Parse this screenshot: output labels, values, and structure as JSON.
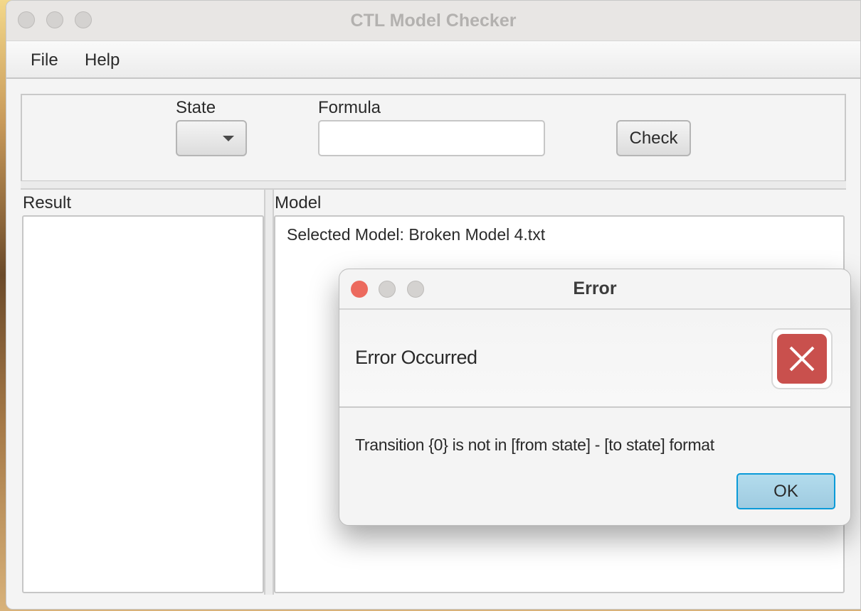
{
  "window": {
    "title": "CTL Model Checker"
  },
  "menu": {
    "items": [
      {
        "label": "File"
      },
      {
        "label": "Help"
      }
    ]
  },
  "controls": {
    "state_label": "State",
    "state_value": "",
    "formula_label": "Formula",
    "formula_value": "",
    "check_label": "Check"
  },
  "result": {
    "label": "Result"
  },
  "model": {
    "label": "Model",
    "text": "Selected Model: Broken Model 4.txt"
  },
  "dialog": {
    "title": "Error",
    "header": "Error Occurred",
    "message": "Transition {0} is not in [from state] - [to state] format",
    "ok_label": "OK",
    "icon": "error-x-icon",
    "accent": "#c9504d"
  }
}
